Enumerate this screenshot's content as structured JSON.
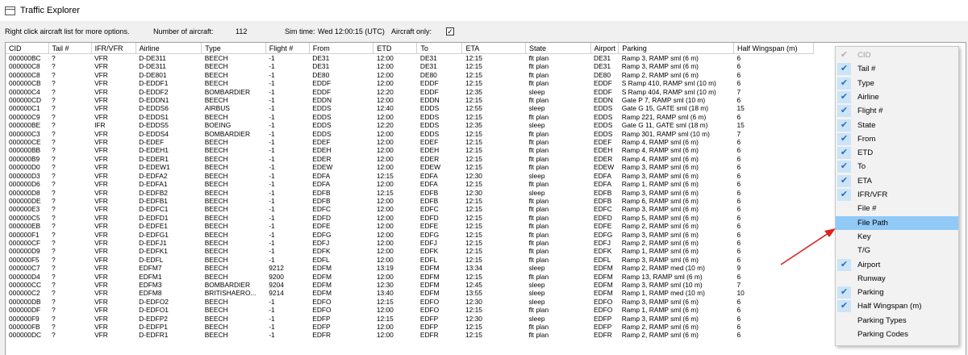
{
  "window": {
    "title": "Traffic Explorer"
  },
  "infobar": {
    "hint": "Right click aircraft list for more options.",
    "count_label": "Number of aircraft:",
    "count_value": "112",
    "simtime_label": "Sim time:",
    "simtime_value": "Wed 12:00:15 (UTC)",
    "aircraft_only_label": "Aircraft only:",
    "aircraft_only_checked": true
  },
  "table": {
    "columns": [
      "CID",
      "Tail #",
      "IFR/VFR",
      "Airline",
      "Type",
      "Flight #",
      "From",
      "ETD",
      "To",
      "ETA",
      "State",
      "Airport",
      "Parking",
      "Half Wingspan (m)"
    ],
    "rows": [
      [
        "000000BC",
        "?",
        "VFR",
        "D-DE311",
        "BEECH",
        "-1",
        "DE31",
        "12:00",
        "DE31",
        "12:15",
        "flt plan",
        "DE31",
        "Ramp 3, RAMP sml (6 m)",
        "6"
      ],
      [
        "000000C8",
        "?",
        "VFR",
        "D-DE311",
        "BEECH",
        "-1",
        "DE31",
        "12:00",
        "DE31",
        "12:15",
        "flt plan",
        "DE31",
        "Ramp 3, RAMP sml (6 m)",
        "6"
      ],
      [
        "000000C8",
        "?",
        "VFR",
        "D-DE801",
        "BEECH",
        "-1",
        "DE80",
        "12:00",
        "DE80",
        "12:15",
        "flt plan",
        "DE80",
        "Ramp 2, RAMP sml (6 m)",
        "6"
      ],
      [
        "000000CB",
        "?",
        "VFR",
        "D-EDDF1",
        "BEECH",
        "-1",
        "EDDF",
        "12:00",
        "EDDF",
        "12:15",
        "flt plan",
        "EDDF",
        "S Ramp 410, RAMP sml (10 m)",
        "6"
      ],
      [
        "000000C4",
        "?",
        "VFR",
        "D-EDDF2",
        "BOMBARDIER",
        "-1",
        "EDDF",
        "12:20",
        "EDDF",
        "12:35",
        "sleep",
        "EDDF",
        "S Ramp 404, RAMP sml (10 m)",
        "7"
      ],
      [
        "000000CD",
        "?",
        "VFR",
        "D-EDDN1",
        "BEECH",
        "-1",
        "EDDN",
        "12:00",
        "EDDN",
        "12:15",
        "flt plan",
        "EDDN",
        "Gate P 7, RAMP sml (10 m)",
        "6"
      ],
      [
        "000000C1",
        "?",
        "VFR",
        "D-EDDS6",
        "AIRBUS",
        "-1",
        "EDDS",
        "12:40",
        "EDDS",
        "12:55",
        "sleep",
        "EDDS",
        "Gate G 15, GATE sml (18 m)",
        "15"
      ],
      [
        "000000C9",
        "?",
        "VFR",
        "D-EDDS1",
        "BEECH",
        "-1",
        "EDDS",
        "12:00",
        "EDDS",
        "12:15",
        "flt plan",
        "EDDS",
        "Ramp 221, RAMP sml (6 m)",
        "6"
      ],
      [
        "000000BE",
        "?",
        "IFR",
        "D-EDDS5",
        "BOEING",
        "-1",
        "EDDS",
        "12:20",
        "EDDS",
        "12:35",
        "sleep",
        "EDDS",
        "Gate G 11, GATE sml (18 m)",
        "15"
      ],
      [
        "000000C3",
        "?",
        "VFR",
        "D-EDDS4",
        "BOMBARDIER",
        "-1",
        "EDDS",
        "12:00",
        "EDDS",
        "12:15",
        "flt plan",
        "EDDS",
        "Ramp 301, RAMP sml (10 m)",
        "7"
      ],
      [
        "000000CE",
        "?",
        "VFR",
        "D-EDEF",
        "BEECH",
        "-1",
        "EDEF",
        "12:00",
        "EDEF",
        "12:15",
        "flt plan",
        "EDEF",
        "Ramp 4, RAMP sml (6 m)",
        "6"
      ],
      [
        "000000BB",
        "?",
        "VFR",
        "D-EDEH1",
        "BEECH",
        "-1",
        "EDEH",
        "12:00",
        "EDEH",
        "12:15",
        "flt plan",
        "EDEH",
        "Ramp 4, RAMP sml (6 m)",
        "6"
      ],
      [
        "000000B9",
        "?",
        "VFR",
        "D-EDER1",
        "BEECH",
        "-1",
        "EDER",
        "12:00",
        "EDER",
        "12:15",
        "flt plan",
        "EDER",
        "Ramp 4, RAMP sml (6 m)",
        "6"
      ],
      [
        "000000D0",
        "?",
        "VFR",
        "D-EDEW1",
        "BEECH",
        "-1",
        "EDEW",
        "12:00",
        "EDEW",
        "12:15",
        "flt plan",
        "EDEW",
        "Ramp 3, RAMP sml (6 m)",
        "6"
      ],
      [
        "000000D3",
        "?",
        "VFR",
        "D-EDFA2",
        "BEECH",
        "-1",
        "EDFA",
        "12:15",
        "EDFA",
        "12:30",
        "sleep",
        "EDFA",
        "Ramp 3, RAMP sml (6 m)",
        "6"
      ],
      [
        "000000D6",
        "?",
        "VFR",
        "D-EDFA1",
        "BEECH",
        "-1",
        "EDFA",
        "12:00",
        "EDFA",
        "12:15",
        "flt plan",
        "EDFA",
        "Ramp 1, RAMP sml (6 m)",
        "6"
      ],
      [
        "000000D8",
        "?",
        "VFR",
        "D-EDFB2",
        "BEECH",
        "-1",
        "EDFB",
        "12:15",
        "EDFB",
        "12:30",
        "sleep",
        "EDFB",
        "Ramp 3, RAMP sml (6 m)",
        "6"
      ],
      [
        "000000DE",
        "?",
        "VFR",
        "D-EDFB1",
        "BEECH",
        "-1",
        "EDFB",
        "12:00",
        "EDFB",
        "12:15",
        "flt plan",
        "EDFB",
        "Ramp 6, RAMP sml (6 m)",
        "6"
      ],
      [
        "000000E3",
        "?",
        "VFR",
        "D-EDFC1",
        "BEECH",
        "-1",
        "EDFC",
        "12:00",
        "EDFC",
        "12:15",
        "flt plan",
        "EDFC",
        "Ramp 3, RAMP sml (6 m)",
        "6"
      ],
      [
        "000000C5",
        "?",
        "VFR",
        "D-EDFD1",
        "BEECH",
        "-1",
        "EDFD",
        "12:00",
        "EDFD",
        "12:15",
        "flt plan",
        "EDFD",
        "Ramp 5, RAMP sml (6 m)",
        "6"
      ],
      [
        "000000EB",
        "?",
        "VFR",
        "D-EDFE1",
        "BEECH",
        "-1",
        "EDFE",
        "12:00",
        "EDFE",
        "12:15",
        "flt plan",
        "EDFE",
        "Ramp 2, RAMP sml (6 m)",
        "6"
      ],
      [
        "000000F1",
        "?",
        "VFR",
        "D-EDFG1",
        "BEECH",
        "-1",
        "EDFG",
        "12:00",
        "EDFG",
        "12:15",
        "flt plan",
        "EDFG",
        "Ramp 3, RAMP sml (6 m)",
        "6"
      ],
      [
        "000000CF",
        "?",
        "VFR",
        "D-EDFJ1",
        "BEECH",
        "-1",
        "EDFJ",
        "12:00",
        "EDFJ",
        "12:15",
        "flt plan",
        "EDFJ",
        "Ramp 2, RAMP sml (6 m)",
        "6"
      ],
      [
        "000000D9",
        "?",
        "VFR",
        "D-EDFK1",
        "BEECH",
        "-1",
        "EDFK",
        "12:00",
        "EDFK",
        "12:15",
        "flt plan",
        "EDFK",
        "Ramp 1, RAMP sml (6 m)",
        "6"
      ],
      [
        "000000F5",
        "?",
        "VFR",
        "D-EDFL",
        "BEECH",
        "-1",
        "EDFL",
        "12:00",
        "EDFL",
        "12:15",
        "flt plan",
        "EDFL",
        "Ramp 3, RAMP sml (6 m)",
        "6"
      ],
      [
        "000000C7",
        "?",
        "VFR",
        "EDFM7",
        "BEECH",
        "9212",
        "EDFM",
        "13:19",
        "EDFM",
        "13:34",
        "sleep",
        "EDFM",
        "Ramp 2, RAMP med (10 m)",
        "9"
      ],
      [
        "000000D4",
        "?",
        "VFR",
        "EDFM1",
        "BEECH",
        "9200",
        "EDFM",
        "12:00",
        "EDFM",
        "12:15",
        "flt plan",
        "EDFM",
        "Ramp 13, RAMP sml (6 m)",
        "6"
      ],
      [
        "000000CC",
        "?",
        "VFR",
        "EDFM3",
        "BOMBARDIER",
        "9204",
        "EDFM",
        "12:30",
        "EDFM",
        "12:45",
        "sleep",
        "EDFM",
        "Ramp 3, RAMP sml (10 m)",
        "7"
      ],
      [
        "000000C2",
        "?",
        "VFR",
        "EDFM8",
        "BRITISHAERO...",
        "9214",
        "EDFM",
        "13:40",
        "EDFM",
        "13:55",
        "sleep",
        "EDFM",
        "Ramp 1, RAMP med (10 m)",
        "10"
      ],
      [
        "000000DB",
        "?",
        "VFR",
        "D-EDFO2",
        "BEECH",
        "-1",
        "EDFO",
        "12:15",
        "EDFO",
        "12:30",
        "sleep",
        "EDFO",
        "Ramp 3, RAMP sml (6 m)",
        "6"
      ],
      [
        "000000DF",
        "?",
        "VFR",
        "D-EDFO1",
        "BEECH",
        "-1",
        "EDFO",
        "12:00",
        "EDFO",
        "12:15",
        "flt plan",
        "EDFO",
        "Ramp 1, RAMP sml (6 m)",
        "6"
      ],
      [
        "000000F9",
        "?",
        "VFR",
        "D-EDFP2",
        "BEECH",
        "-1",
        "EDFP",
        "12:15",
        "EDFP",
        "12:30",
        "sleep",
        "EDFP",
        "Ramp 3, RAMP sml (6 m)",
        "6"
      ],
      [
        "000000FB",
        "?",
        "VFR",
        "D-EDFP1",
        "BEECH",
        "-1",
        "EDFP",
        "12:00",
        "EDFP",
        "12:15",
        "flt plan",
        "EDFP",
        "Ramp 2, RAMP sml (6 m)",
        "6"
      ],
      [
        "000000DC",
        "?",
        "VFR",
        "D-EDFR1",
        "BEECH",
        "-1",
        "EDFR",
        "12:00",
        "EDFR",
        "12:15",
        "flt plan",
        "EDFR",
        "Ramp 2, RAMP sml (6 m)",
        "6"
      ]
    ]
  },
  "context_menu": {
    "items": [
      {
        "label": "CID",
        "checked": true,
        "disabled": true
      },
      {
        "label": "Tail #",
        "checked": true
      },
      {
        "label": "Type",
        "checked": true
      },
      {
        "label": "Airline",
        "checked": true
      },
      {
        "label": "Flight #",
        "checked": true
      },
      {
        "label": "State",
        "checked": true
      },
      {
        "label": "From",
        "checked": true
      },
      {
        "label": "ETD",
        "checked": true
      },
      {
        "label": "To",
        "checked": true
      },
      {
        "label": "ETA",
        "checked": true
      },
      {
        "label": "IFR/VFR",
        "checked": true
      },
      {
        "label": "File #",
        "checked": false
      },
      {
        "label": "File Path",
        "checked": false,
        "highlighted": true
      },
      {
        "label": "Key",
        "checked": false
      },
      {
        "label": "T/G",
        "checked": false
      },
      {
        "label": "Airport",
        "checked": true
      },
      {
        "label": "Runway",
        "checked": false
      },
      {
        "label": "Parking",
        "checked": true
      },
      {
        "label": "Half Wingspan (m)",
        "checked": true
      },
      {
        "label": "Parking Types",
        "checked": false
      },
      {
        "label": "Parking Codes",
        "checked": false
      }
    ]
  },
  "colors": {
    "check_bg": "#cce4f7",
    "check_mark": "#2b6cbf",
    "highlight": "#91c9f7",
    "arrow": "#e02020"
  }
}
